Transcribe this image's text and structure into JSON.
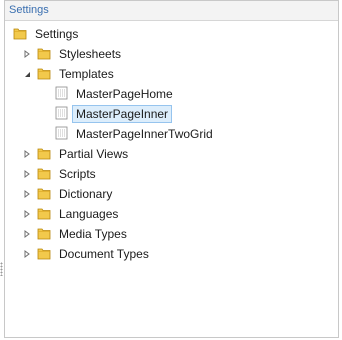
{
  "header": {
    "title": "Settings"
  },
  "tree": {
    "root": {
      "label": "Settings",
      "icon": "folder-icon"
    },
    "items": [
      {
        "label": "Stylesheets",
        "expanded": false,
        "icon": "folder-icon"
      },
      {
        "label": "Templates",
        "expanded": true,
        "icon": "folder-icon",
        "children": [
          {
            "label": "MasterPageHome",
            "icon": "template-icon",
            "selected": false
          },
          {
            "label": "MasterPageInner",
            "icon": "template-icon",
            "selected": true
          },
          {
            "label": "MasterPageInnerTwoGrid",
            "icon": "template-icon",
            "selected": false
          }
        ]
      },
      {
        "label": "Partial Views",
        "expanded": false,
        "icon": "folder-icon"
      },
      {
        "label": "Scripts",
        "expanded": false,
        "icon": "folder-icon"
      },
      {
        "label": "Dictionary",
        "expanded": false,
        "icon": "folder-icon"
      },
      {
        "label": "Languages",
        "expanded": false,
        "icon": "folder-icon"
      },
      {
        "label": "Media Types",
        "expanded": false,
        "icon": "folder-icon"
      },
      {
        "label": "Document Types",
        "expanded": false,
        "icon": "folder-icon"
      }
    ]
  },
  "colors": {
    "header_text": "#3a6fb0",
    "folder": "#f2c94c",
    "selection_bg": "#dcedfb",
    "selection_border": "#96c4ee"
  }
}
